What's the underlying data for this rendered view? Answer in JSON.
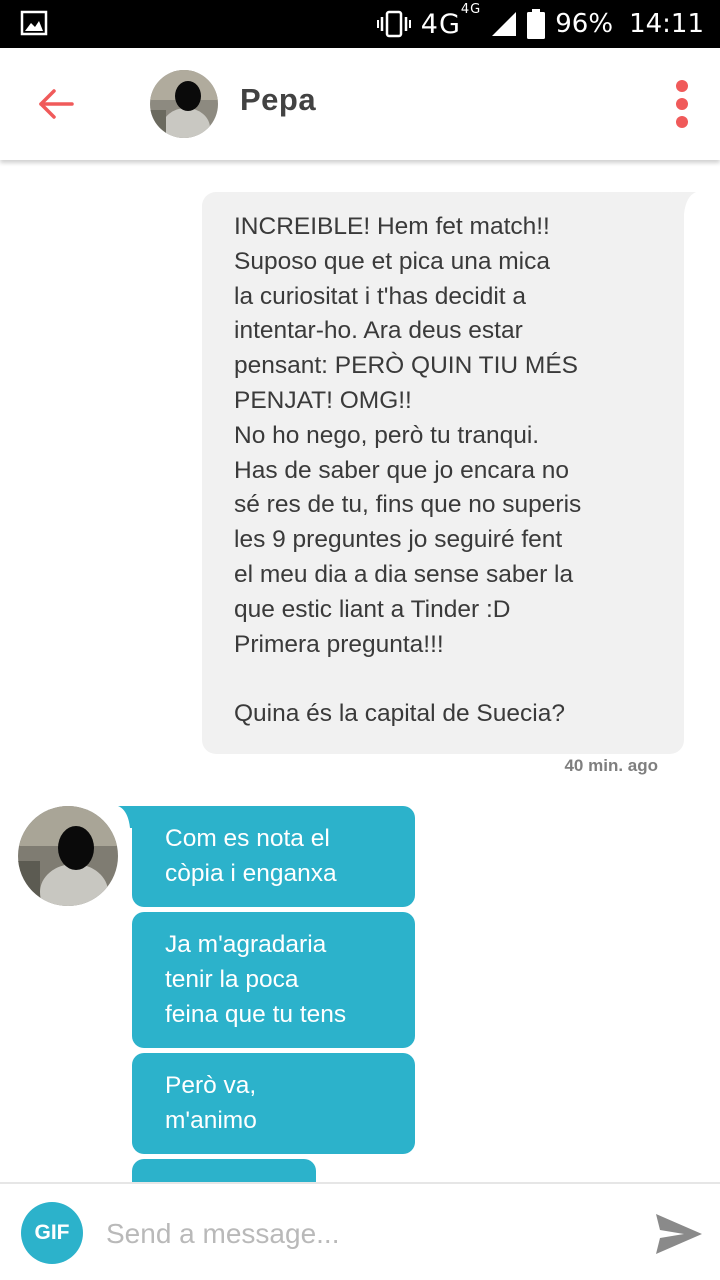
{
  "status_bar": {
    "network": "4G",
    "network_small": "4G",
    "battery": "96%",
    "time": "14:11",
    "icons": [
      "gallery-icon",
      "vibrate-icon",
      "signal-icon",
      "battery-icon"
    ]
  },
  "header": {
    "contact_name": "Pepa",
    "icons": [
      "back-arrow-icon",
      "more-vert-icon"
    ],
    "accent_color": "#f05a5a"
  },
  "thread": {
    "sent_message": "INCREIBLE! Hem fet match!!\nSuposo que et pica una mica\nla curiositat i t'has decidit a\nintentar-ho. Ara deus estar\npensant: PERÒ QUIN TIU MÉS\nPENJAT! OMG!!\nNo ho nego, però tu tranqui.\nHas de saber que jo encara no\nsé res de tu, fins que no superis\nles 9 preguntes jo seguiré fent\nel meu dia a dia sense saber la\nque estic liant a Tinder :D\nPrimera pregunta!!!\n\nQuina és la capital de Suecia?",
    "sent_timestamp": "40 min. ago",
    "received_messages": [
      "Com es nota el\ncòpia i enganxa",
      "Ja m'agradaria\ntenir la poca\nfeina que tu tens",
      "Però va,\nm'animo",
      ""
    ],
    "sent_bubble_color": "#f1f1f1",
    "received_bubble_color": "#2cb2cb"
  },
  "composer": {
    "gif_label": "GIF",
    "placeholder": "Send a message...",
    "icons": [
      "send-icon"
    ]
  }
}
